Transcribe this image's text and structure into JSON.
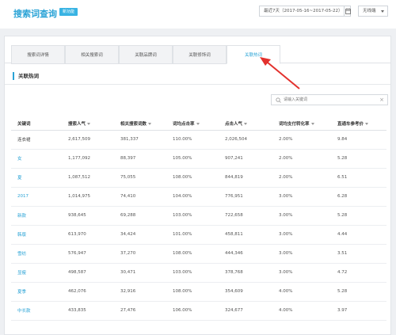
{
  "header": {
    "title": "搜索词查询",
    "badge": "新功能",
    "date_range": "最近7天（2017-05-16~2017-05-22）",
    "device": "无线端"
  },
  "tabs": [
    {
      "label": "搜索词详情"
    },
    {
      "label": "相关搜索词"
    },
    {
      "label": "关联品牌词"
    },
    {
      "label": "关联修饰词"
    },
    {
      "label": "关联热词",
      "active": true
    }
  ],
  "section": {
    "title": "关联热词"
  },
  "search": {
    "placeholder": "请输入关键词",
    "clear": "×"
  },
  "table": {
    "columns": [
      "关键词",
      "搜索人气",
      "相关搜索词数",
      "词均点击率",
      "点击人气",
      "词均支付转化率",
      "直通车参考价"
    ],
    "rows": [
      [
        "连衣裙",
        "2,617,509",
        "381,337",
        "110.00%",
        "2,026,504",
        "2.00%",
        "9.84"
      ],
      [
        "女",
        "1,177,092",
        "88,397",
        "105.00%",
        "907,241",
        "2.00%",
        "5.28"
      ],
      [
        "夏",
        "1,087,512",
        "75,055",
        "108.00%",
        "844,819",
        "2.00%",
        "6.51"
      ],
      [
        "2017",
        "1,014,975",
        "74,410",
        "104.00%",
        "776,951",
        "3.00%",
        "6.28"
      ],
      [
        "新款",
        "938,645",
        "69,288",
        "103.00%",
        "722,658",
        "3.00%",
        "5.28"
      ],
      [
        "韩版",
        "613,970",
        "34,424",
        "101.00%",
        "458,811",
        "3.00%",
        "4.44"
      ],
      [
        "雪纺",
        "576,947",
        "37,270",
        "108.00%",
        "444,346",
        "3.00%",
        "3.51"
      ],
      [
        "显瘦",
        "498,587",
        "30,471",
        "103.00%",
        "378,768",
        "3.00%",
        "4.72"
      ],
      [
        "夏季",
        "462,076",
        "32,916",
        "108.00%",
        "354,609",
        "4.00%",
        "5.28"
      ],
      [
        "中长款",
        "433,835",
        "27,476",
        "106.00%",
        "324,677",
        "4.00%",
        "3.97"
      ]
    ]
  },
  "colors": {
    "accent": "#2aa3d6",
    "arrow": "#e3312d"
  }
}
